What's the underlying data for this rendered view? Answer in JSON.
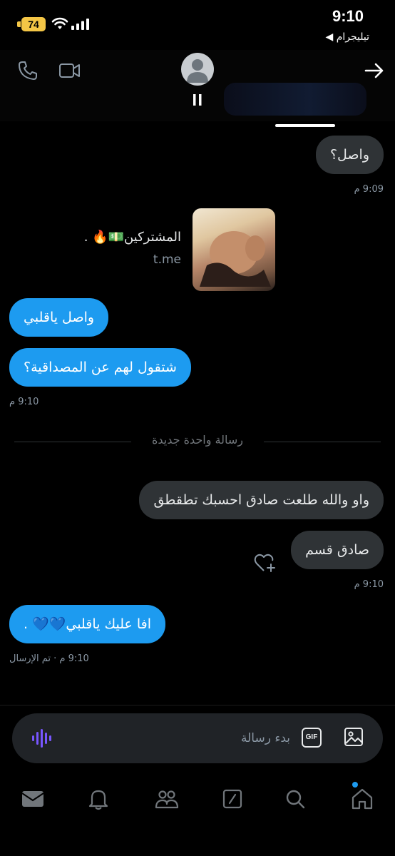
{
  "status_bar": {
    "time": "9:10",
    "battery": "74",
    "back_app": "◀ تيليجرام"
  },
  "messages": [
    {
      "text": "واصل؟",
      "side": "mine"
    },
    {
      "meta": "9:09 م"
    },
    {
      "link_title": "المشتركين💵🔥 .",
      "link_domain": "t.me"
    },
    {
      "text": "واصل ياقلبي",
      "side": "theirs"
    },
    {
      "text": "شتقول لهم عن المصداقية؟",
      "side": "theirs"
    },
    {
      "meta": "9:10 م"
    },
    {
      "divider": "رسالة واحدة جديدة"
    },
    {
      "text": "واو والله طلعت صادق احسبك تطقطق",
      "side": "mine"
    },
    {
      "text": "صادق قسم",
      "side": "mine"
    },
    {
      "meta": "9:10 م"
    },
    {
      "text": "افا عليك ياقلبي💙💙 .",
      "side": "theirs"
    },
    {
      "meta": "9:10 م · تم الإرسال"
    }
  ],
  "composer": {
    "placeholder": "بدء رسالة",
    "gif_label": "GIF"
  },
  "colors": {
    "accent": "#1d9bf0",
    "mine_bubble": "#2f3336",
    "background": "#000000"
  },
  "icons": {
    "header": [
      "phone-icon",
      "video-icon",
      "arrow-right-icon"
    ],
    "nav": [
      "mail-icon",
      "bell-icon",
      "people-icon",
      "compose-icon",
      "search-icon",
      "home-icon"
    ]
  }
}
